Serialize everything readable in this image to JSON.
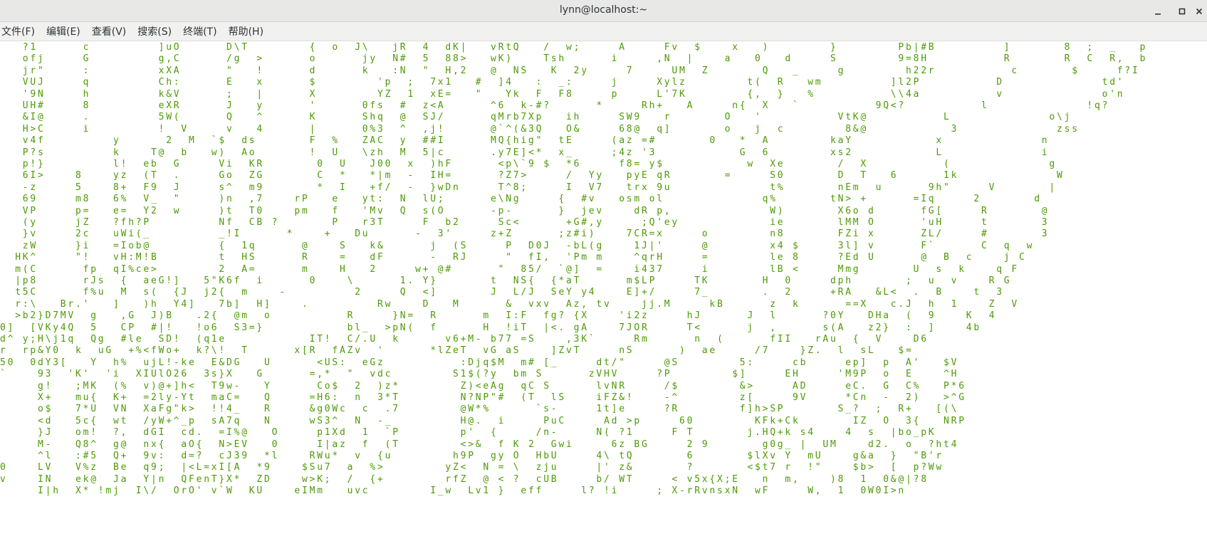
{
  "window": {
    "title": "lynn@localhost:~"
  },
  "menu": [
    "文件(F)",
    "编辑(E)",
    "查看(V)",
    "搜索(S)",
    "终端(T)",
    "帮助(H)"
  ],
  "colors": {
    "matrix_green": "#4e9a06",
    "matrix_faded": "#c9c9c9",
    "titlebar_bg": "#e8e8e7",
    "menubar_bg": "#f1f1f0",
    "terminal_bg": "#ffffff"
  },
  "icons": [
    "minimize-icon",
    "maximize-icon",
    "close-icon"
  ],
  "terminal": {
    "lines": [
      "   ?1      c         ]uO      D\\T        {  o  J\\   jR  4  dK|   vRtQ   /  w;     A     Fv  $    x   )        }        Pb|#B         ]       8  ;  _   p",
      "   ofj     G         g,C      /g  >      o      jy  N#  5  88>   wK)    Tsh      i     ,N  |    a   0   d     S        9=8H          R       R  C  R,  b",
      "   jr\"     :         xXA      \"   !      d      k   :N  \"  H,2   @  NS   K  2y     7     UM  Z       Q   _     g        h22r          c       $     f?I",
      "   VUJ     q         Ch:      E   x      $        'p  ;  7x1   #  ]4   :  _:     j     Xylz        t(  R   wm         ]l2P          D             td'",
      "   '9N     h         k&V      ;   |      X        YZ  1  xE=   \"   Yk  F  F8     p     L'7K        {,  }   %          \\\\4a          v             o'n",
      "   UH#     8         eXR      J   y      '      0fs  #  z<A      ^6  k-#?      *     Rh+   A     n{  X   `          9Q<?          l             !q?",
      "   &I@     .         5W(      Q   ^      K      Shq  @  SJ/      qMrb7Xp   ih     SW9   r       O   '          VtK@          L             o\\j",
      "   H>C     i         !  V     v   4      |      0%3  ^  ,j!      @`^(&3Q   O&     68@  q]       o   j  c        8&@           3             zss",
      "   v4f         y      2  M  `$  ds       F  %   ZAC  y  ##I      MQ{hig\"  tE     (az =#       0   *  A        kaY           x             n",
      "   P?s         k    T@  b   w)  Ao       !  U   \\zh  M  5|c      .y7E]<*  x_     ;4z '3           G  6        xs2           L             i",
      "   p!}         l!  eb  G     Vi  KR       0  U   J00  x  )hF      <p\\`9 $  *6     f8= y$           w  Xe       /  X          (             g",
      "   6I>    8    yz  (T  .     Go  ZG       C  *   *|m  -  IH=      ?Z7>     /  Yy   pyE qR       =     S0       D  T   6      1k             W",
      "   -z     5    8+  F9  J     s^  m9       *  I   +f/  -  }wDn     T^8;     I  V7   trx 9u             t%       nEm  u      9h\"     V       |",
      "   69     m8   6%  V_  \"     )n  ,7    rP   e   yt:  N  lU;      e\\Ng     {  #v   osm ol             q%       tN> +      =Iq     2       d",
      "   VP     p=   e=  Y2  w     )t  T0    pm   f   'Mv  Q  s(O      -p-      }  jev    dR p,             W)       X6o d      fG[     R       @",
      "   (y     jZ   ?fh?P         Nf  CB ?       P   r3T     F  b2     Sc<      +G#,y     ;Q'ey            ie       lMM O      'uH     t       3",
      "   }v     2c   uWi(_         _!I      *    +   Du      -  3'     z+Z      ;z#i)    7CR=x     o        n8       FZi x      ZL/     #       3",
      "   zW     }i   =Iob@         {  1q      @    S   k&      j  (S     P  D0J  -bL(g    1J|'     @        x4 $     3l] v      F`      C  q  w",
      "  HK^     \"!   vH:M!B        t  HS      R    =   dF      -  RJ     \"  fI,  'Pm m    ^qrH     =        le 8     ?Ed U      @  B  c    j C",
      "  m(C      fp  qI%ce>        2  A=      m    H   2     w+ @#      \"  85/  `@]  =    i437     i        lB <     Mmg       U  s  k    q F",
      "  |p8      rJs  {  aeG!]   5\"K6f  i      0    \\      1. Y}       t  NS{  {*aT      m$LP     TK       H  0     dph       ;  u  v    R G",
      "  t5C      f%u  M  s(  {J  j2{  m    -         2     Q  <]       J  L/J  SeY y4    E]+/     7_       .  2     +RA   &L<  .  B    t  3",
      "  r:\\   Br.'   ]   )h  Y4]   7b]  H]    .         Rw    D   M      &  vxv  Az, tv    jj.M     kB      z  k      ==X   c.J  h  1    Z  V",
      "  >b2}D7MV  g   ,G  J)B   .2{  @m  o          R     }N=  R      m  I:F  fg? {X    'i2z     hJ      J  l      ?0Y   DHa  (  9    K  4",
      "0]  [VKy4Q  5   CP  #|!   !o6  S3=}           bl_  >pN(  f      H  !iT  |<. gA    7JOR     T<      j  ,      s(A   z2}  :  ]    4b",
      "d^ y;H\\j1q  Qg  #le  SD!  (q1e           IT!  C/.U  k      v6+M- b77 =S    ,3K`     Rm      n  (      fII   rAu  {  V    D6",
      "r  rp&Y0  k  uG  +%<fWo+  k?\\!  T      x[R  fAZv  '      *lZeT  vG aS    ]ZvT     nS      )  ae     /7    }Z.  l  sL   $=",
      "50  0dY3[   Y  h%  ujL!-ke  E&DG   U      <US:  eGz          :Djq$M  m# [_     dt/\"     @S        5:     cb     ep]  p  A'   $V",
      "`    93  'K'  'i  XIUlO26  3s}X   G      =,*  \"  vdc        S1$(?y  bm S      zVHV     ?P        $]     EH     'M9P  o  E    ^H",
      "     g!   ;MK  (%  v)@+]h<  T9w-   Y      Co$  2  )z*        Z)<eAg  qC S      lvNR     /$        &>     AD     eC.  G  C%   P*6",
      "     X+   mu{  K+  =2ly-Yt  maC=   Q     =H6:  n  3*T        N?NP\"#  (T  lS    iFZ&!    -^        z[     9V     *Cn  -  2)   >^G",
      "     o$   7*U  VN  XaFg\"k>  !!4_   R     &g0Wc  c  .7        @W*%      `s-     1t]e     ?R        f]h>SP       S_?  ;  R+   [(\\",
      "     <d   5c{  wt  /yW+^_p  sA7q   N     wS3^  N  -_         H@.  i     PuC     Ad >p     60        KFk+Ck       IZ  O  3{   NRP",
      "     }J   om!  ?,  dGI  cd.  =I%@   O     p1Xd  1  `P        p'  {     /n-     N( ?1     F T       j.HQ+k s4    4  s  |bo_pK",
      "     M-   Q8^  g@  nx{  aO{  N>EV   0     I|az  f  (T        <>&  f K 2  Gwi     6z BG     2 9       g0g_ |  UM    d2.  o  ?ht4",
      "     ^l   :#5  Q+  9v:  d=?  cJ39  *l    RWu*  v  {u        h9P  gy O  HbU     4\\ tQ       6       $lXv Y  mU    g&a  }  \"B'r",
      "0    LV   V%z  Be  q9;  |<L=xI[A  *9    $Su7  a  %>        yZ<  N = \\  zju     |' z&       ?       <$t7 r  !\"    $b>  [  p?Ww",
      "v    IN   ek@  Ja  Y|n  QFenT}X*  ZD    w>K;  /  {+        rfZ  @ < ?  cUB     b/ WT     < v5x{X;E   n  m,    )8  1  0&@|?8",
      "     I|h  X* !mj  I\\/  OrO' v`W  KU    eIMm   uvc        I_w  Lv1 }  eff     l? !i     ; X-rRvnsxN  wF     W,  1  0W0I>n"
    ]
  }
}
